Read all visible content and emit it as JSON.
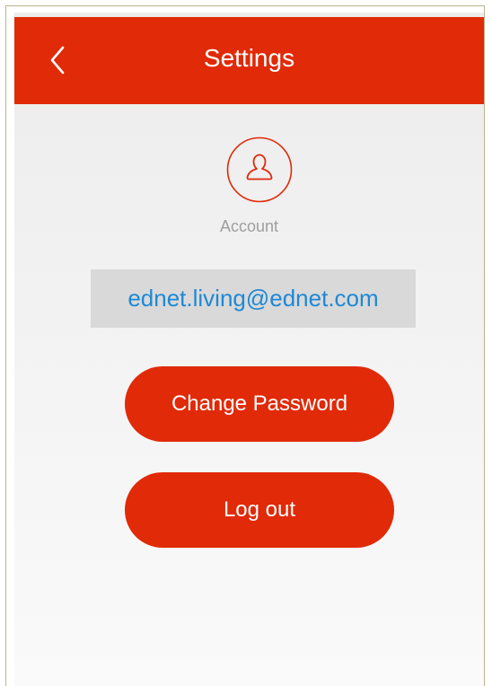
{
  "header": {
    "title": "Settings",
    "back_icon": "chevron-left-icon"
  },
  "account": {
    "icon": "user-icon",
    "label": "Account",
    "email": "ednet.living@ednet.com"
  },
  "actions": {
    "change_password_label": "Change Password",
    "logout_label": "Log out"
  },
  "colors": {
    "accent": "#e02a08",
    "email_text": "#1e88d6",
    "email_background": "#d9d9d9",
    "label_text": "#9e9e9e"
  }
}
